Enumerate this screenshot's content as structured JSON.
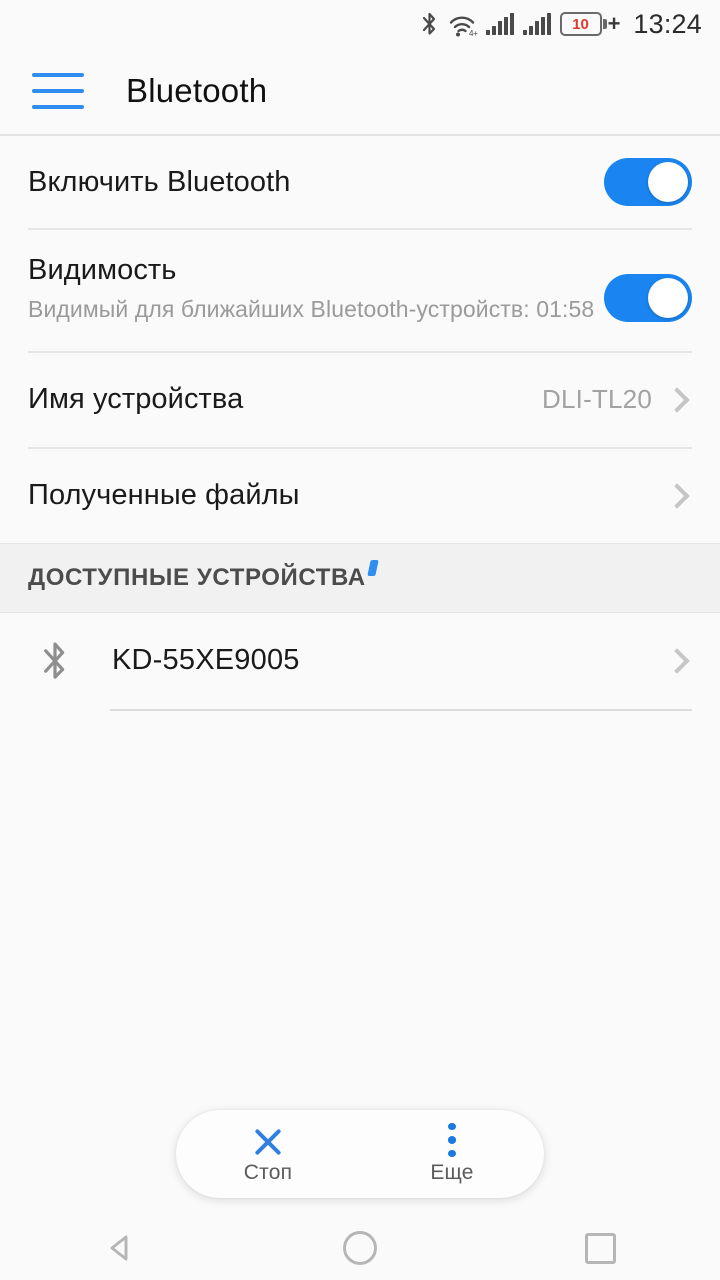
{
  "statusbar": {
    "bluetooth_icon": "bluetooth-icon",
    "wifi_icon": "wifi-icon",
    "wifi_badge": "4+",
    "signal_icon_1": "cellular-signal-icon",
    "signal_icon_2": "cellular-signal-icon",
    "battery_level": "10",
    "battery_charging": "+",
    "clock": "13:24"
  },
  "appbar": {
    "menu_icon": "hamburger-menu-icon",
    "title": "Bluetooth"
  },
  "settings": {
    "enable": {
      "title": "Включить Bluetooth",
      "toggle_on": true
    },
    "visibility": {
      "title": "Видимость",
      "subtitle": "Видимый для ближайших Bluetooth-устройств: 01:58",
      "toggle_on": true
    },
    "device_name": {
      "title": "Имя устройства",
      "value": "DLI-TL20"
    },
    "received_files": {
      "title": "Полученные файлы"
    }
  },
  "available_section": {
    "header": "ДОСТУПНЫЕ УСТРОЙСТВА",
    "scanning": true,
    "devices": [
      {
        "name": "KD-55XE9005",
        "icon": "bluetooth-device-icon"
      }
    ]
  },
  "action_bar": {
    "stop": {
      "label": "Стоп",
      "icon": "close-x-icon"
    },
    "more": {
      "label": "Еще",
      "icon": "three-dots-vertical-icon"
    }
  },
  "navbar": {
    "back": "back-triangle-icon",
    "home": "home-circle-icon",
    "recents": "recents-square-icon"
  },
  "colors": {
    "accent": "#2f8ef0",
    "toggle_on": "#1a85f0",
    "battery_warning": "#e03a2f",
    "page_bg": "#fafafa",
    "section_bg": "#f1f1f1"
  }
}
